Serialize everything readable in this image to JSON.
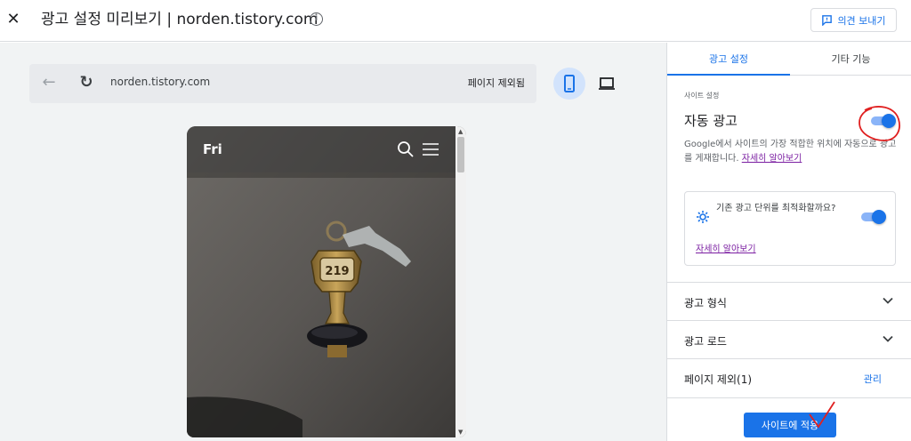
{
  "header": {
    "close_symbol": "✕",
    "title": "광고 설정 미리보기 | norden.tistory.com",
    "info_symbol": "i",
    "feedback_label": "의견 보내기"
  },
  "preview": {
    "url": "norden.tistory.com",
    "exclude_page_label": "페이지 제외됨",
    "back_symbol": "←",
    "reload_symbol": "↻",
    "selected_device": "mobile",
    "site": {
      "brand": "Fri",
      "keytag_number": "219"
    }
  },
  "panel": {
    "tabs": [
      {
        "label": "광고 설정",
        "active": true
      },
      {
        "label": "기타 기능",
        "active": false
      }
    ],
    "site_settings_label": "사이트 설정",
    "auto_ads": {
      "title": "자동 광고",
      "enabled": true,
      "description": "Google에서 사이트의 가장 적합한 위치에 자동으로 광고를 게재합니다.",
      "learn_more": "자세히 알아보기"
    },
    "optimize": {
      "text": "기존 광고 단위를 최적화할까요?",
      "enabled": true,
      "learn_more": "자세히 알아보기"
    },
    "sections": [
      {
        "label": "광고 형식"
      },
      {
        "label": "광고 로드"
      }
    ],
    "page_exclusions": {
      "label": "페이지 제외(1)",
      "action": "관리"
    },
    "apply_label": "사이트에 적용"
  },
  "colors": {
    "accent": "#1a73e8",
    "link_visited": "#7b1fa2",
    "annotation": "#e02020"
  }
}
